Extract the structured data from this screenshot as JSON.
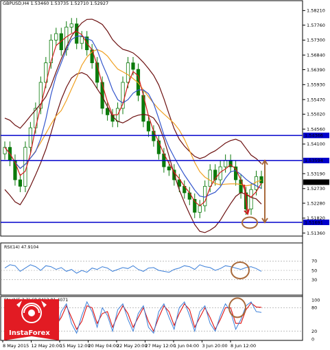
{
  "header": {
    "title": "GBPUSD,H4 1.53460 1.53735 1.52710 1.52927"
  },
  "colors": {
    "candle": "#0b7a0b",
    "bands": "#6b0f0f",
    "ma_fast": "#d11b1b",
    "ma_mid": "#3355cc",
    "ma_slow": "#f0a020",
    "level_line": "#0000cc",
    "annotation": "#a8693a",
    "arrow_red": "#cc2222",
    "rsi": "#3a7ed8",
    "stoch_main": "#3a7ed8",
    "stoch_signal": "#dd1111"
  },
  "indicators": {
    "rsi_label": "RSI(14) 47.9104",
    "stoch_label": "Stoch(5,3,3) 68.8413 81.4071",
    "rsi_ticks": [
      "70",
      "50",
      "30"
    ],
    "stoch_ticks": [
      "100",
      "80",
      "20",
      "0"
    ]
  },
  "price_axis": {
    "ticks": [
      "1.58210",
      "1.57760",
      "1.57300",
      "1.56840",
      "1.56390",
      "1.55930",
      "1.55470",
      "1.55020",
      "1.54560",
      "1.54100",
      "1.53190",
      "1.52730",
      "1.52280",
      "1.51820",
      "1.51360"
    ],
    "highlight_resist_upper": "1.54366",
    "highlight_resist": "1.53594",
    "highlight_price": "1.52927",
    "highlight_support": "1.51691"
  },
  "time_axis": {
    "ticks": [
      "8 May 2015",
      "12 May 20:00",
      "15 May 12:00",
      "20 May 04:00",
      "22 May 20:00",
      "27 May 12:00",
      "1 Jun 04:00",
      "3 Jun 20:00",
      "8 Jun 12:00"
    ]
  },
  "logo": {
    "text": "InstaForex"
  },
  "chart_data": {
    "type": "candlestick",
    "symbol": "GBPUSD",
    "timeframe": "H4",
    "ohlc_last": {
      "open": 1.5346,
      "high": 1.53735,
      "low": 1.5271,
      "close": 1.52927
    },
    "ylim": [
      1.5131,
      1.5845
    ],
    "horizontal_levels": [
      1.54366,
      1.53594,
      1.51691
    ],
    "close_series": [
      1.54,
      1.536,
      1.53,
      1.528,
      1.54,
      1.546,
      1.552,
      1.56,
      1.566,
      1.573,
      1.575,
      1.57,
      1.577,
      1.578,
      1.572,
      1.574,
      1.57,
      1.566,
      1.56,
      1.552,
      1.55,
      1.548,
      1.552,
      1.56,
      1.566,
      1.564,
      1.556,
      1.548,
      1.545,
      1.542,
      1.538,
      1.534,
      1.533,
      1.53,
      1.528,
      1.526,
      1.524,
      1.52,
      1.522,
      1.528,
      1.533,
      1.53,
      1.534,
      1.536,
      1.534,
      1.53,
      1.526,
      1.521,
      1.527,
      1.531,
      1.529
    ],
    "rsi": {
      "value": 47.9104,
      "levels": [
        70,
        50,
        30
      ],
      "series": [
        55,
        62,
        60,
        48,
        55,
        62,
        58,
        50,
        60,
        58,
        52,
        56,
        48,
        52,
        44,
        50,
        46,
        55,
        52,
        58,
        55,
        48,
        52,
        56,
        54,
        60,
        52,
        48,
        55,
        56,
        50,
        48,
        46,
        52,
        55,
        60,
        58,
        52,
        62,
        58,
        56,
        50,
        54,
        60,
        58,
        55,
        52,
        56,
        58,
        54,
        48
      ]
    },
    "stochastic": {
      "main": 68.8413,
      "signal": 81.4071,
      "levels": [
        100,
        80,
        20,
        0
      ],
      "series_main": [
        40,
        80,
        60,
        20,
        70,
        95,
        50,
        20,
        85,
        60,
        20,
        70,
        90,
        40,
        15,
        60,
        95,
        70,
        30,
        80,
        60,
        20,
        75,
        90,
        50,
        20,
        65,
        85,
        30,
        15,
        70,
        90,
        55,
        25,
        80,
        95,
        60,
        20,
        70,
        85,
        40,
        20,
        60,
        90,
        70,
        25,
        50,
        85,
        95,
        70,
        68
      ],
      "series_signal": [
        45,
        70,
        65,
        35,
        55,
        85,
        65,
        30,
        70,
        70,
        35,
        55,
        85,
        55,
        25,
        45,
        85,
        80,
        40,
        65,
        70,
        30,
        60,
        85,
        65,
        30,
        55,
        80,
        45,
        20,
        55,
        85,
        70,
        35,
        65,
        90,
        75,
        30,
        55,
        80,
        55,
        25,
        50,
        80,
        80,
        40,
        40,
        75,
        92,
        82,
        81
      ]
    }
  }
}
